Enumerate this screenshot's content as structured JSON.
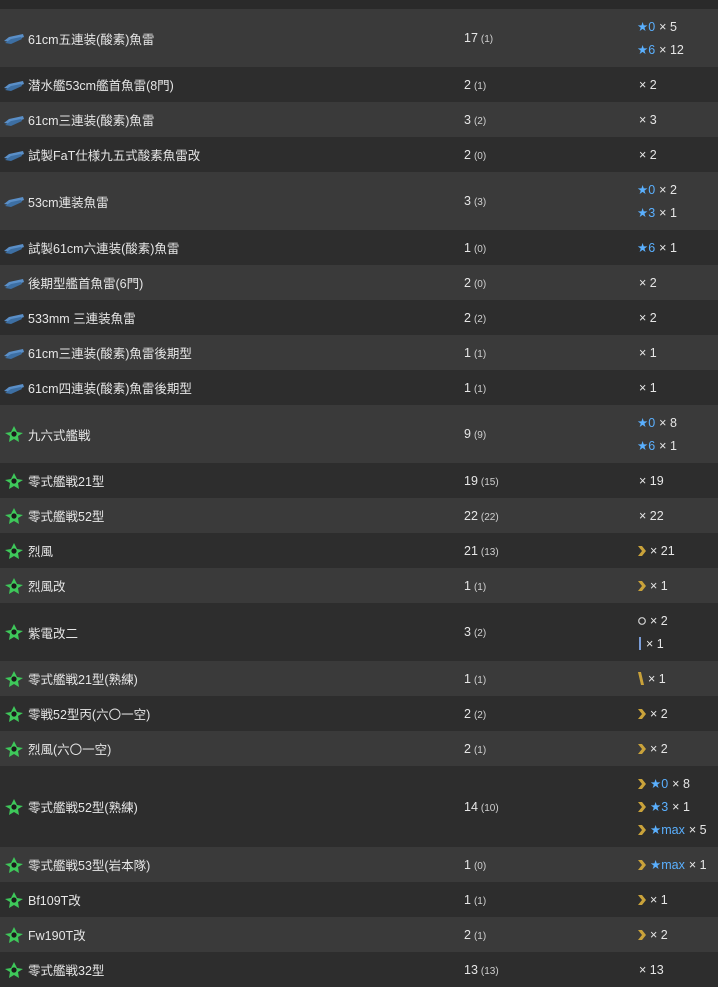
{
  "rows": [
    {
      "name": "61cm五連装(酸素)魚雷",
      "type": "torpedo",
      "count": "17",
      "count_sub": "(1)",
      "imp": [
        {
          "star": "0",
          "mult": "× 5"
        },
        {
          "star": "6",
          "mult": "× 12"
        }
      ]
    },
    {
      "name": "潜水艦53cm艦首魚雷(8門)",
      "type": "torpedo",
      "count": "2",
      "count_sub": "(1)",
      "imp": [
        {
          "mult": "× 2"
        }
      ]
    },
    {
      "name": "61cm三連装(酸素)魚雷",
      "type": "torpedo",
      "count": "3",
      "count_sub": "(2)",
      "imp": [
        {
          "mult": "× 3"
        }
      ]
    },
    {
      "name": "試製FaT仕様九五式酸素魚雷改",
      "type": "torpedo",
      "count": "2",
      "count_sub": "(0)",
      "imp": [
        {
          "mult": "× 2"
        }
      ]
    },
    {
      "name": "53cm連装魚雷",
      "type": "torpedo",
      "count": "3",
      "count_sub": "(3)",
      "imp": [
        {
          "star": "0",
          "mult": "× 2"
        },
        {
          "star": "3",
          "mult": "× 1"
        }
      ]
    },
    {
      "name": "試製61cm六連装(酸素)魚雷",
      "type": "torpedo",
      "count": "1",
      "count_sub": "(0)",
      "imp": [
        {
          "star": "6",
          "mult": "× 1"
        }
      ]
    },
    {
      "name": "後期型艦首魚雷(6門)",
      "type": "torpedo",
      "count": "2",
      "count_sub": "(0)",
      "imp": [
        {
          "mult": "× 2"
        }
      ]
    },
    {
      "name": "533mm 三連装魚雷",
      "type": "torpedo",
      "count": "2",
      "count_sub": "(2)",
      "imp": [
        {
          "mult": "× 2"
        }
      ]
    },
    {
      "name": "61cm三連装(酸素)魚雷後期型",
      "type": "torpedo",
      "count": "1",
      "count_sub": "(1)",
      "imp": [
        {
          "mult": "× 1"
        }
      ]
    },
    {
      "name": "61cm四連装(酸素)魚雷後期型",
      "type": "torpedo",
      "count": "1",
      "count_sub": "(1)",
      "imp": [
        {
          "mult": "× 1"
        }
      ]
    },
    {
      "name": "九六式艦戦",
      "type": "fighter",
      "count": "9",
      "count_sub": "(9)",
      "imp": [
        {
          "star": "0",
          "mult": "× 8"
        },
        {
          "star": "6",
          "mult": "× 1"
        }
      ]
    },
    {
      "name": "零式艦戦21型",
      "type": "fighter",
      "count": "19",
      "count_sub": "(15)",
      "imp": [
        {
          "mult": "× 19"
        }
      ]
    },
    {
      "name": "零式艦戦52型",
      "type": "fighter",
      "count": "22",
      "count_sub": "(22)",
      "imp": [
        {
          "mult": "× 22"
        }
      ]
    },
    {
      "name": "烈風",
      "type": "fighter",
      "count": "21",
      "count_sub": "(13)",
      "imp": [
        {
          "prof": "chevron",
          "mult": "× 21"
        }
      ]
    },
    {
      "name": "烈風改",
      "type": "fighter",
      "count": "1",
      "count_sub": "(1)",
      "imp": [
        {
          "prof": "chevron",
          "mult": "× 1"
        }
      ]
    },
    {
      "name": "紫電改二",
      "type": "fighter",
      "count": "3",
      "count_sub": "(2)",
      "imp": [
        {
          "prof": "circle",
          "mult": "× 2"
        },
        {
          "prof": "bar-blue",
          "mult": "× 1"
        }
      ]
    },
    {
      "name": "零式艦戦21型(熟練)",
      "type": "fighter",
      "count": "1",
      "count_sub": "(1)",
      "imp": [
        {
          "prof": "bar-gold",
          "mult": "× 1"
        }
      ]
    },
    {
      "name": "零戦52型丙(六〇一空)",
      "type": "fighter",
      "count": "2",
      "count_sub": "(2)",
      "imp": [
        {
          "prof": "chevron",
          "mult": "× 2"
        }
      ]
    },
    {
      "name": "烈風(六〇一空)",
      "type": "fighter",
      "count": "2",
      "count_sub": "(1)",
      "imp": [
        {
          "prof": "chevron",
          "mult": "× 2"
        }
      ]
    },
    {
      "name": "零式艦戦52型(熟練)",
      "type": "fighter",
      "count": "14",
      "count_sub": "(10)",
      "imp": [
        {
          "prof": "chevron",
          "star": "0",
          "mult": "× 8"
        },
        {
          "prof": "chevron",
          "star": "3",
          "mult": "× 1"
        },
        {
          "prof": "chevron",
          "star": "max",
          "mult": "× 5"
        }
      ]
    },
    {
      "name": "零式艦戦53型(岩本隊)",
      "type": "fighter",
      "count": "1",
      "count_sub": "(0)",
      "imp": [
        {
          "prof": "chevron",
          "star": "max",
          "mult": "× 1"
        }
      ]
    },
    {
      "name": "Bf109T改",
      "type": "fighter",
      "count": "1",
      "count_sub": "(1)",
      "imp": [
        {
          "prof": "chevron",
          "mult": "× 1"
        }
      ]
    },
    {
      "name": "Fw190T改",
      "type": "fighter",
      "count": "2",
      "count_sub": "(1)",
      "imp": [
        {
          "prof": "chevron",
          "mult": "× 2"
        }
      ]
    },
    {
      "name": "零式艦戦32型",
      "type": "fighter",
      "count": "13",
      "count_sub": "(13)",
      "imp": [
        {
          "mult": "× 13"
        }
      ]
    }
  ],
  "colors": {
    "star_blue": "#5ab0ff",
    "proficiency_gold": "#c9a23a",
    "proficiency_blue": "#7a9cd6",
    "torpedo_blue": "#5a8fc8",
    "fighter_green": "#3ec85a"
  },
  "symbols": {
    "star": "★"
  }
}
